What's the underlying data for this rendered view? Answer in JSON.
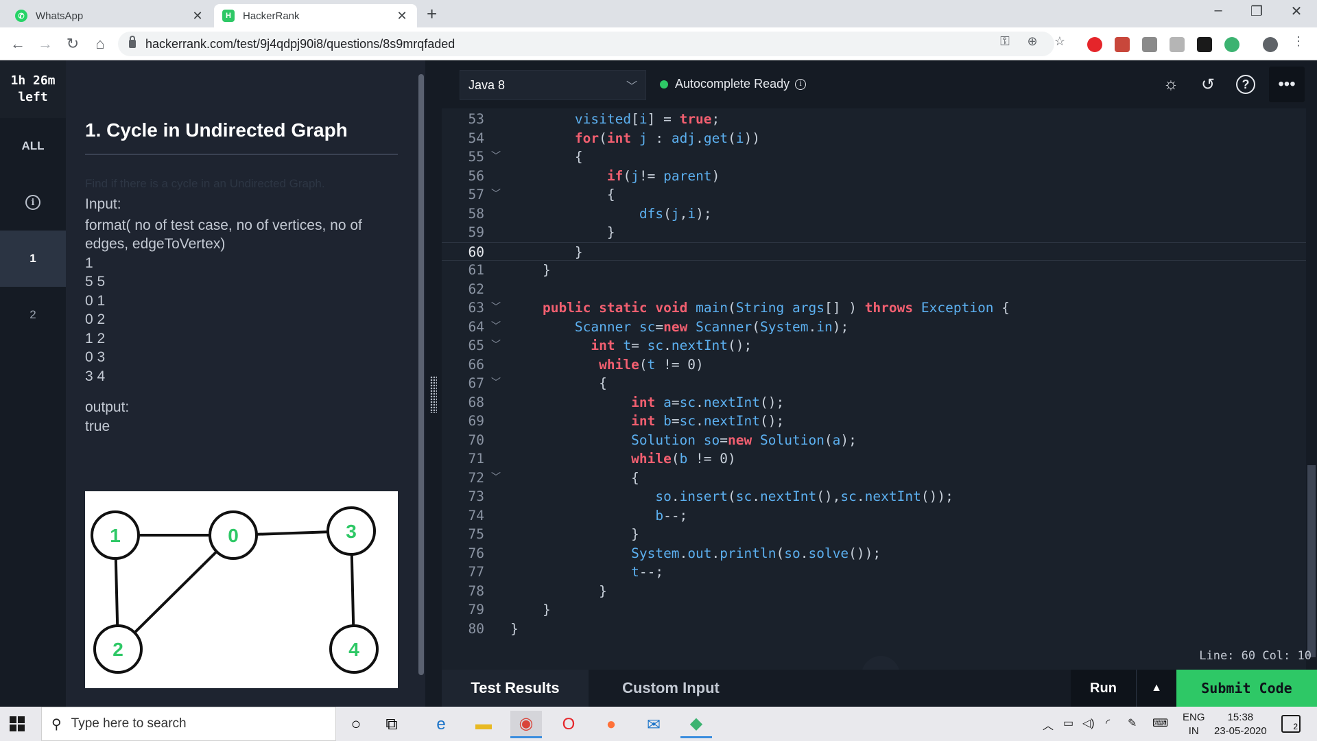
{
  "browser": {
    "tabs": [
      {
        "title": "WhatsApp",
        "favicon": "whatsapp-icon"
      },
      {
        "title": "HackerRank",
        "favicon": "hackerrank-icon"
      }
    ],
    "url": "hackerrank.com/test/9j4qdpj90i8/questions/8s9mrqfaded"
  },
  "sidebar": {
    "timer_line1": "1h 26m",
    "timer_line2": "left",
    "all_label": "ALL",
    "items": [
      {
        "label": "1"
      },
      {
        "label": "2"
      }
    ]
  },
  "problem": {
    "title": "1. Cycle in Undirected Graph",
    "description": "Find if there is a cycle in an Undirected Graph.",
    "input_label": "Input:",
    "format_text": "format( no of test case, no of vertices, no of edges, edgeToVertex)",
    "sample_input": [
      "1",
      "5 5",
      "0 1",
      "0 2",
      "1 2",
      "0 3",
      "3 4"
    ],
    "output_label": "output:",
    "sample_output": "true",
    "graph": {
      "nodes": [
        "1",
        "0",
        "3",
        "2",
        "4"
      ],
      "edges": [
        [
          "1",
          "0"
        ],
        [
          "0",
          "3"
        ],
        [
          "1",
          "2"
        ],
        [
          "0",
          "2"
        ],
        [
          "3",
          "4"
        ]
      ],
      "node_color": "#2ec866"
    }
  },
  "editor": {
    "language": "Java 8",
    "autocomplete_status": "Autocomplete Ready",
    "cursor_status": "Line: 60 Col: 10",
    "current_line": 60,
    "lines": [
      {
        "n": "53",
        "fold": false
      },
      {
        "n": "54",
        "fold": false
      },
      {
        "n": "55",
        "fold": true
      },
      {
        "n": "56",
        "fold": false
      },
      {
        "n": "57",
        "fold": true
      },
      {
        "n": "58",
        "fold": false
      },
      {
        "n": "59",
        "fold": false
      },
      {
        "n": "60",
        "fold": false
      },
      {
        "n": "61",
        "fold": false
      },
      {
        "n": "62",
        "fold": false
      },
      {
        "n": "63",
        "fold": true
      },
      {
        "n": "64",
        "fold": true
      },
      {
        "n": "65",
        "fold": true
      },
      {
        "n": "66",
        "fold": false
      },
      {
        "n": "67",
        "fold": true
      },
      {
        "n": "68",
        "fold": false
      },
      {
        "n": "69",
        "fold": false
      },
      {
        "n": "70",
        "fold": false
      },
      {
        "n": "71",
        "fold": false
      },
      {
        "n": "72",
        "fold": true
      },
      {
        "n": "73",
        "fold": false
      },
      {
        "n": "74",
        "fold": false
      },
      {
        "n": "75",
        "fold": false
      },
      {
        "n": "76",
        "fold": false
      },
      {
        "n": "77",
        "fold": false
      },
      {
        "n": "78",
        "fold": false
      },
      {
        "n": "79",
        "fold": false
      },
      {
        "n": "80",
        "fold": false
      }
    ],
    "code_text": [
      "        visited[i] = true;",
      "        for(int j : adj.get(i))",
      "        {",
      "            if(j!= parent)",
      "            {",
      "                dfs(j,i);",
      "            }",
      "        }",
      "    }",
      "",
      "    public static void main(String args[] ) throws Exception {",
      "        Scanner sc=new Scanner(System.in);",
      "          int t= sc.nextInt();",
      "           while(t != 0)",
      "           {",
      "               int a=sc.nextInt();",
      "               int b=sc.nextInt();",
      "               Solution so=new Solution(a);",
      "               while(b != 0)",
      "               {",
      "                  so.insert(sc.nextInt(),sc.nextInt());",
      "                  b--;",
      "               }",
      "               System.out.println(so.solve());",
      "               t--;",
      "           }",
      "    }",
      "}"
    ]
  },
  "bottom": {
    "test_results": "Test Results",
    "custom_input": "Custom Input",
    "run": "Run",
    "submit": "Submit Code"
  },
  "taskbar": {
    "search_placeholder": "Type here to search",
    "lang_line1": "ENG",
    "lang_line2": "IN",
    "time": "15:38",
    "date": "23-05-2020",
    "notifications": "2"
  }
}
